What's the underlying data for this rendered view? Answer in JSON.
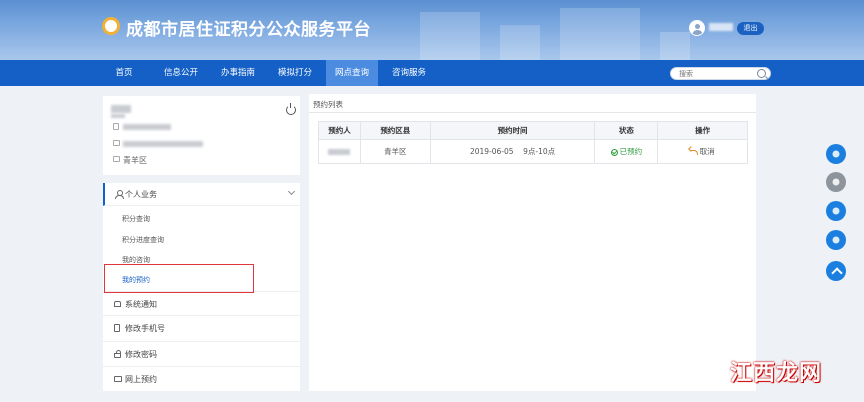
{
  "header": {
    "title": "成都市居住证积分公众服务平台",
    "logout_label": "退出"
  },
  "nav": {
    "items": [
      {
        "label": "首页"
      },
      {
        "label": "信息公开"
      },
      {
        "label": "办事指南"
      },
      {
        "label": "模拟打分"
      },
      {
        "label": "网点查询"
      },
      {
        "label": "咨询服务"
      }
    ],
    "active_index": 4,
    "search_placeholder": "搜索"
  },
  "profile": {
    "district": "青羊区"
  },
  "menu": {
    "section_label": "个人业务",
    "sub_items": [
      {
        "label": "积分查询"
      },
      {
        "label": "积分进度查询"
      },
      {
        "label": "我的咨询"
      },
      {
        "label": "我的预约"
      }
    ],
    "active_sub_index": 3,
    "items": [
      {
        "label": "系统通知",
        "icon": "bell-icon"
      },
      {
        "label": "修改手机号",
        "icon": "phone-icon"
      },
      {
        "label": "修改密码",
        "icon": "lock-icon"
      },
      {
        "label": "网上预约",
        "icon": "monitor-icon"
      }
    ]
  },
  "main": {
    "title": "预约列表",
    "columns": [
      "预约人",
      "预约区县",
      "预约时间",
      "状态",
      "操作"
    ],
    "rows": [
      {
        "district": "青羊区",
        "time": "2019-06-05    9点-10点",
        "status": "已预约",
        "action": "取消"
      }
    ]
  },
  "side_buttons": [
    {
      "icon": "wechat-icon"
    },
    {
      "icon": "weibo-icon"
    },
    {
      "icon": "customer-service-icon"
    },
    {
      "icon": "phone-icon"
    },
    {
      "icon": "back-to-top-icon"
    }
  ],
  "watermark": "江西龙网",
  "colors": {
    "primary": "#1460c6",
    "nav_active": "#4c8ce0",
    "status_ok": "#2f9b3f",
    "highlight_border": "#e0353b"
  }
}
